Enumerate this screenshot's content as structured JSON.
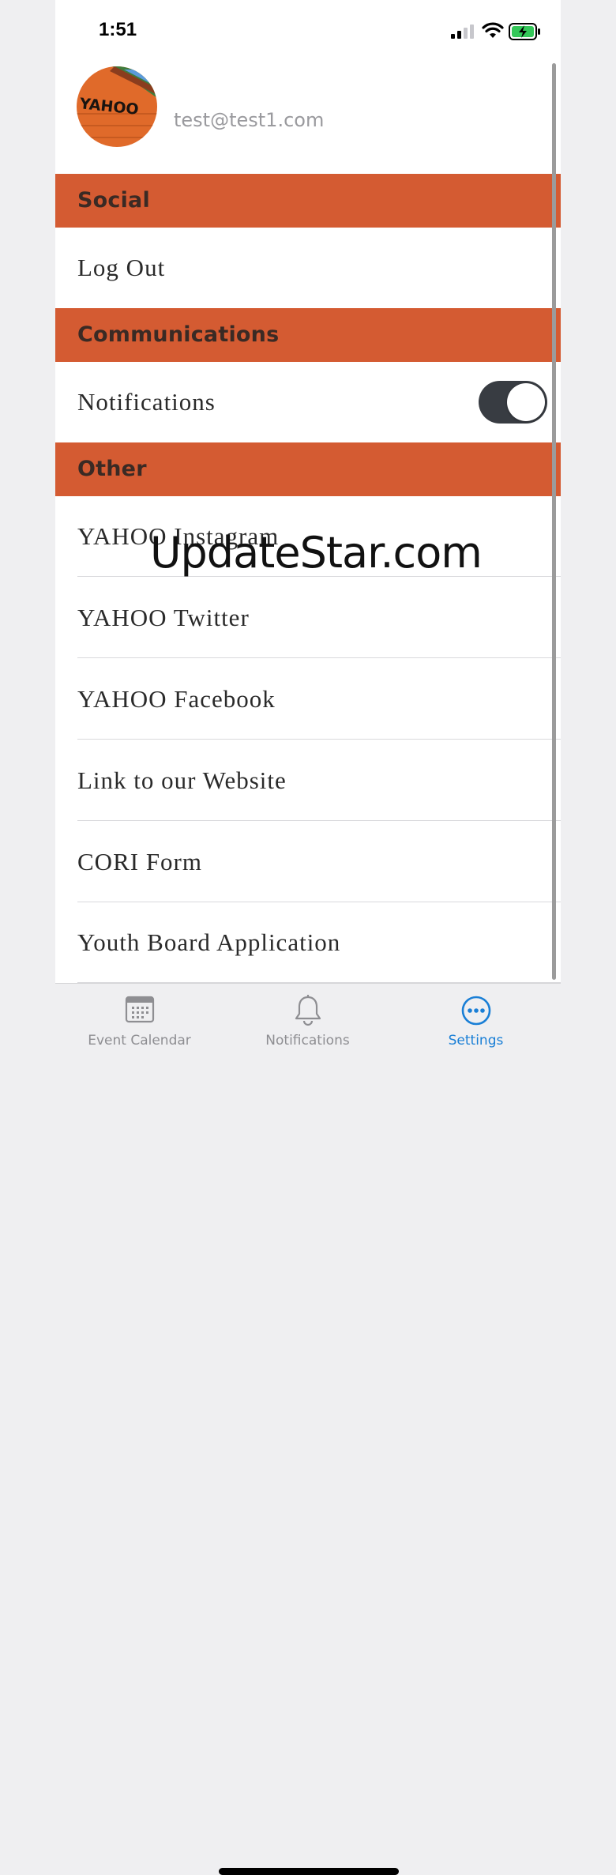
{
  "status_bar": {
    "time": "1:51"
  },
  "profile": {
    "email": "test@test1.com",
    "avatar_text": "YAHOO"
  },
  "sections": {
    "social": {
      "title": "Social",
      "items": [
        "Log Out"
      ]
    },
    "communications": {
      "title": "Communications",
      "notifications_label": "Notifications",
      "notifications_on": true
    },
    "other": {
      "title": "Other",
      "items": [
        "YAHOO Instagram",
        "YAHOO Twitter",
        "YAHOO Facebook",
        "Link to our Website",
        "CORI Form",
        "Youth Board Application"
      ]
    }
  },
  "watermark": "UpdateStar.com",
  "tabbar": {
    "tabs": [
      {
        "label": "Event Calendar",
        "icon": "calendar-icon",
        "active": false
      },
      {
        "label": "Notifications",
        "icon": "bell-icon",
        "active": false
      },
      {
        "label": "Settings",
        "icon": "more-icon",
        "active": true
      }
    ]
  },
  "colors": {
    "section_header": "#d45b32",
    "active_tab": "#1a7fd6",
    "toggle_on": "#383c42"
  }
}
